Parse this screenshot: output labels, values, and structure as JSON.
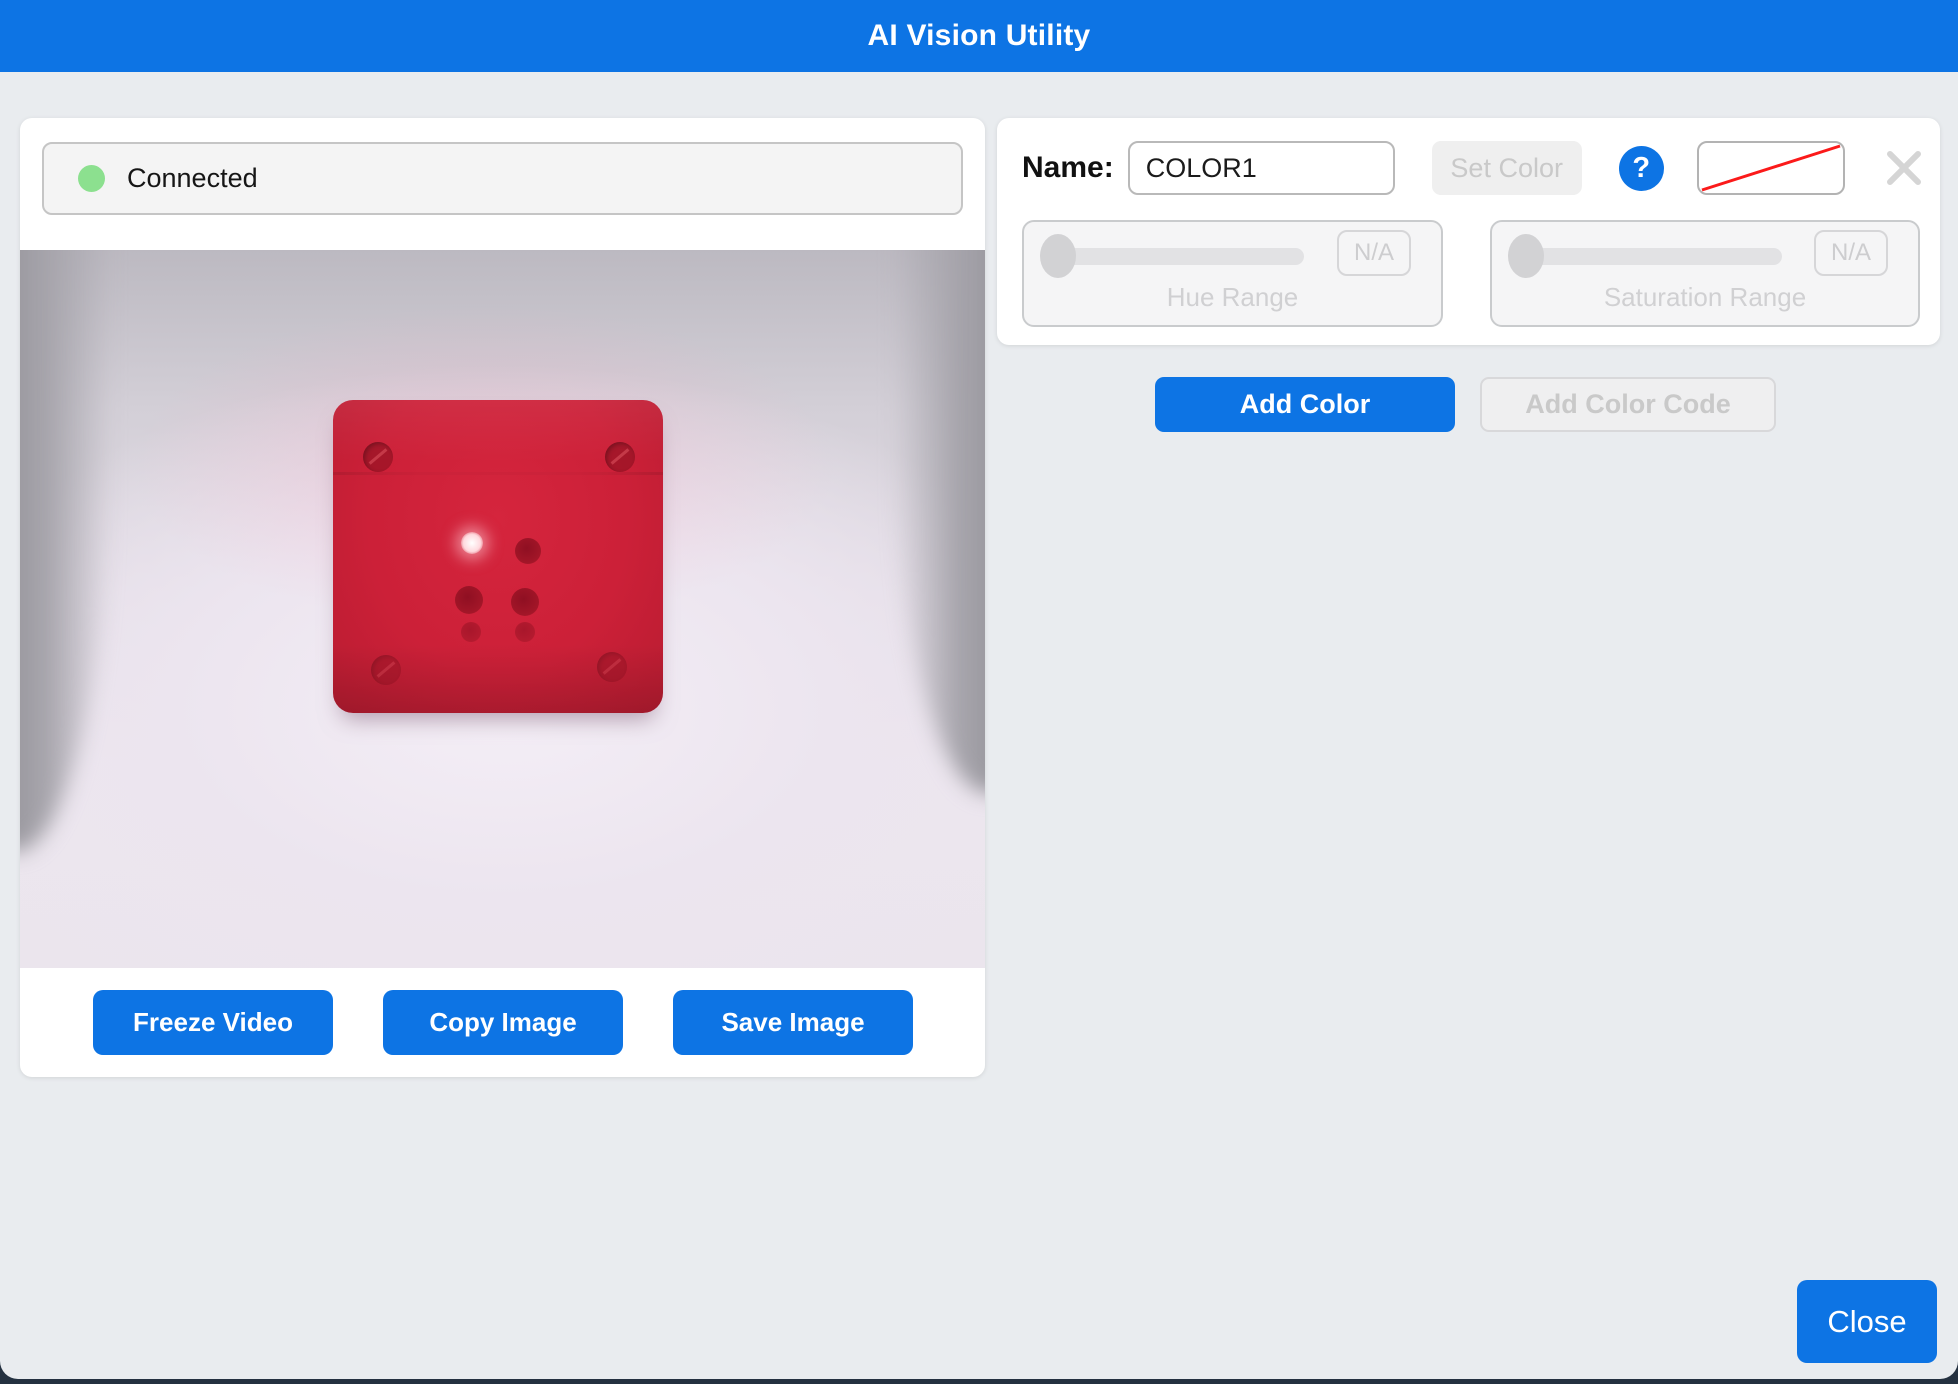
{
  "window": {
    "title": "AI Vision Utility"
  },
  "status": {
    "label": "Connected"
  },
  "video": {
    "description": "Live camera feed: red cube centered on white light-box backdrop"
  },
  "video_buttons": {
    "freeze": "Freeze Video",
    "copy": "Copy Image",
    "save": "Save Image"
  },
  "color_editor": {
    "name_label": "Name:",
    "name_value": "COLOR1",
    "set_color": "Set Color",
    "help": "?",
    "hue": {
      "label": "Hue Range",
      "value": "N/A"
    },
    "saturation": {
      "label": "Saturation Range",
      "value": "N/A"
    }
  },
  "actions": {
    "add_color": "Add Color",
    "add_color_code": "Add Color Code"
  },
  "footer": {
    "close": "Close"
  },
  "colors": {
    "accent_blue": "#0d74e4",
    "status_green": "#8ce08f",
    "swatch_slash_red": "#fb1a1a",
    "cube_red": "#cc2038",
    "background_grey": "#e9ecef",
    "disabled_text": "#c9c9c9"
  }
}
